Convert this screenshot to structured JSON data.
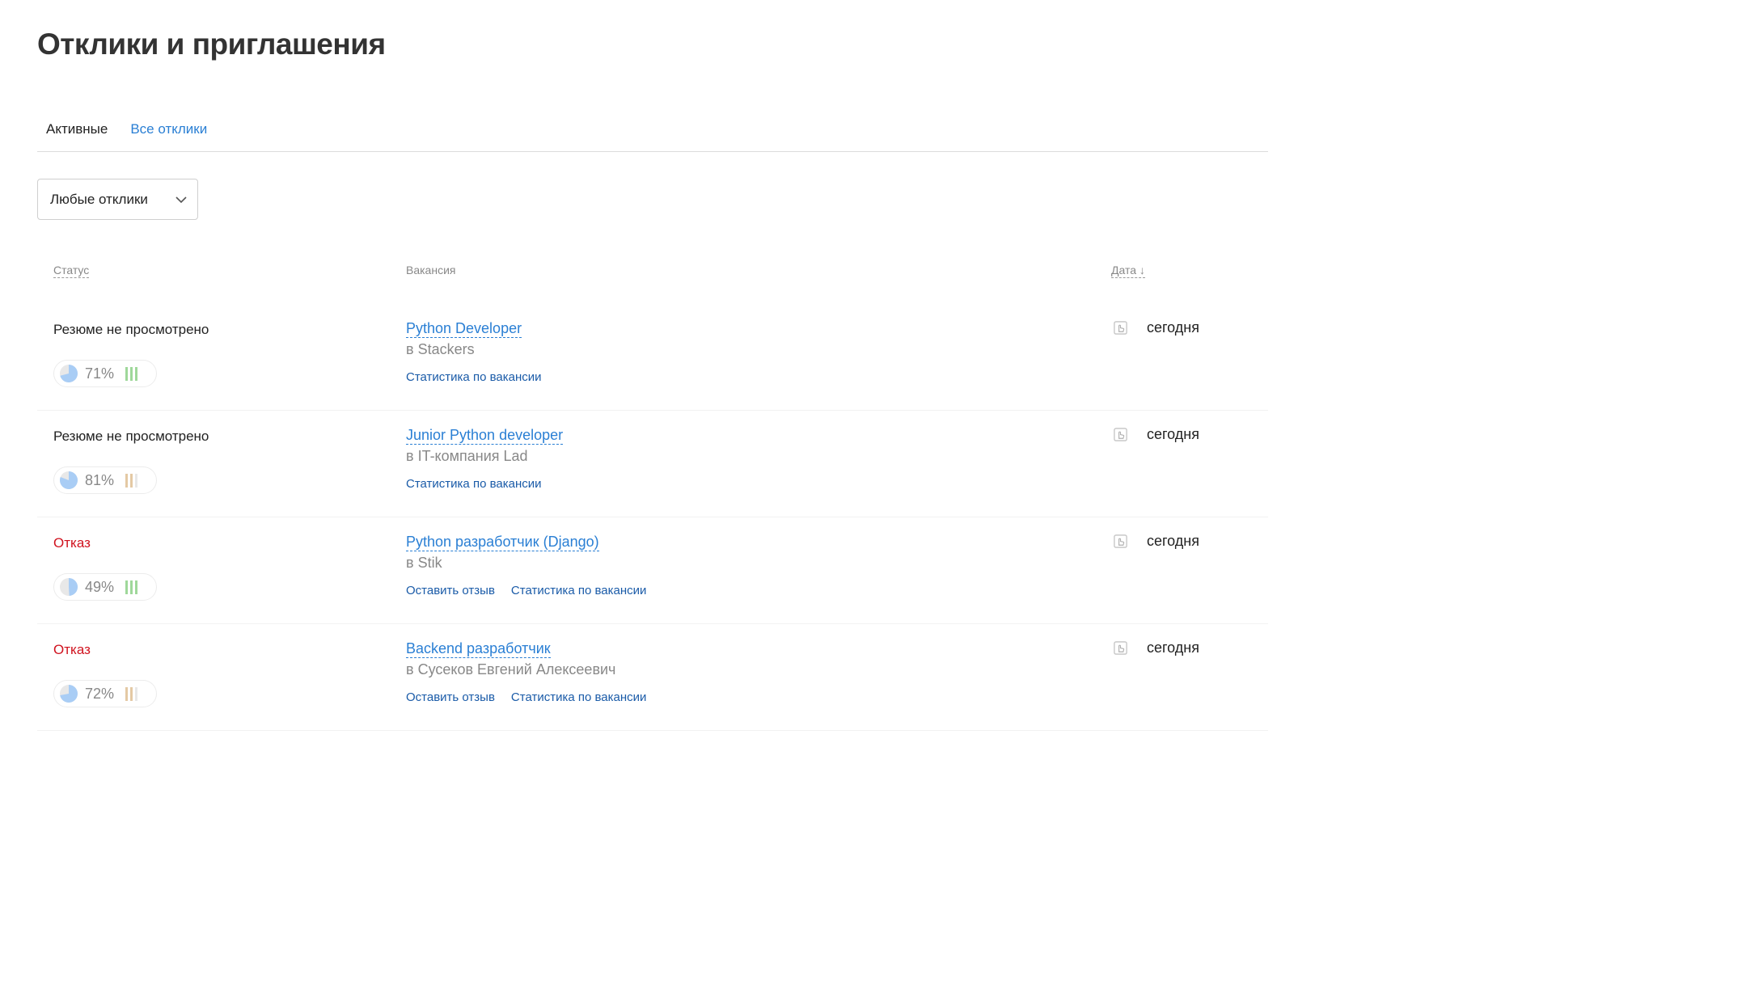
{
  "page": {
    "title": "Отклики и приглашения"
  },
  "tabs": [
    {
      "label": "Активные"
    },
    {
      "label": "Все отклики"
    }
  ],
  "filter": {
    "value": "Любые отклики"
  },
  "table": {
    "headers": {
      "status": "Статус",
      "vacancy": "Вакансия",
      "date": "Дата ↓"
    },
    "rows": [
      {
        "status": "Резюме не просмотрено",
        "status_type": "pending",
        "match_percent": "71%",
        "match_fill": 0.71,
        "bar_colors": [
          "#9fd89a",
          "#9fd89a",
          "#9fd89a"
        ],
        "vacancy": "Python Developer",
        "company": "в Stackers",
        "links": [
          "Статистика по вакансии"
        ],
        "date": "сегодня"
      },
      {
        "status": "Резюме не просмотрено",
        "status_type": "pending",
        "match_percent": "81%",
        "match_fill": 0.81,
        "bar_colors": [
          "#e4c9a4",
          "#e4c9a4",
          "#e8e8e8"
        ],
        "vacancy": "Junior Python developer",
        "company": "в IT-компания Lad",
        "links": [
          "Статистика по вакансии"
        ],
        "date": "сегодня"
      },
      {
        "status": "Отказ",
        "status_type": "reject",
        "match_percent": "49%",
        "match_fill": 0.49,
        "bar_colors": [
          "#9fd89a",
          "#9fd89a",
          "#9fd89a"
        ],
        "vacancy": "Python разработчик (Django)",
        "company": "в Stik",
        "links": [
          "Оставить отзыв",
          "Статистика по вакансии"
        ],
        "date": "сегодня"
      },
      {
        "status": "Отказ",
        "status_type": "reject",
        "match_percent": "72%",
        "match_fill": 0.72,
        "bar_colors": [
          "#e4c9a4",
          "#e4c9a4",
          "#e8e8e8"
        ],
        "vacancy": "Backend разработчик",
        "company": "в Сусеков Евгений Алексеевич",
        "links": [
          "Оставить отзыв",
          "Статистика по вакансии"
        ],
        "date": "сегодня"
      }
    ]
  },
  "colors": {
    "link": "#2a7fd4",
    "link_dark": "#1a5ba8",
    "reject": "#d0121e",
    "pie": "#a9cdf5"
  },
  "icons": {
    "filter_dropdown": "chevron-down-icon",
    "date": "hand-pointer-icon"
  }
}
